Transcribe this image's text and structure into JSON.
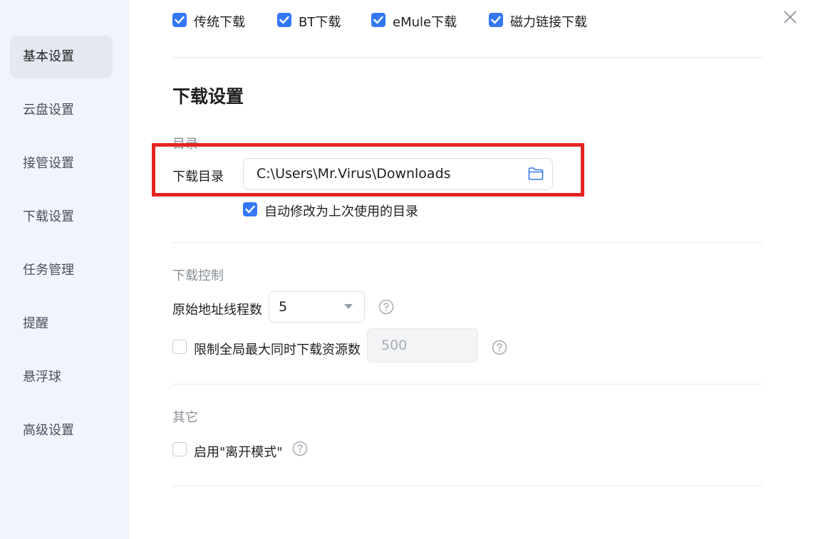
{
  "sidebar": {
    "items": [
      {
        "label": "基本设置",
        "active": true
      },
      {
        "label": "云盘设置"
      },
      {
        "label": "接管设置"
      },
      {
        "label": "下载设置"
      },
      {
        "label": "任务管理"
      },
      {
        "label": "提醒"
      },
      {
        "label": "悬浮球"
      },
      {
        "label": "高级设置"
      }
    ]
  },
  "takeover": {
    "options": [
      {
        "label": "传统下载",
        "checked": true
      },
      {
        "label": "BT下载",
        "checked": true
      },
      {
        "label": "eMule下载",
        "checked": true
      },
      {
        "label": "磁力链接下载",
        "checked": true
      }
    ]
  },
  "download": {
    "section_title": "下载设置",
    "directory": {
      "group_title": "目录",
      "label": "下载目录",
      "path": "C:\\Users\\Mr.Virus\\Downloads",
      "auto_change_label": "自动修改为上次使用的目录",
      "auto_change_checked": true
    },
    "control": {
      "group_title": "下载控制",
      "threads_label": "原始地址线程数",
      "threads_value": "5",
      "limit_label": "限制全局最大同时下载资源数",
      "limit_checked": false,
      "limit_value": "500"
    },
    "other": {
      "group_title": "其它",
      "away_mode_label": "启用\"离开模式\"",
      "away_mode_checked": false
    }
  },
  "colors": {
    "accent": "#3478f6",
    "highlight": "#e52421",
    "sidebar_bg": "#f1f5fb"
  },
  "icons": {
    "close": "close-icon",
    "folder": "folder-icon",
    "help": "help-icon",
    "check": "checkmark-icon"
  }
}
